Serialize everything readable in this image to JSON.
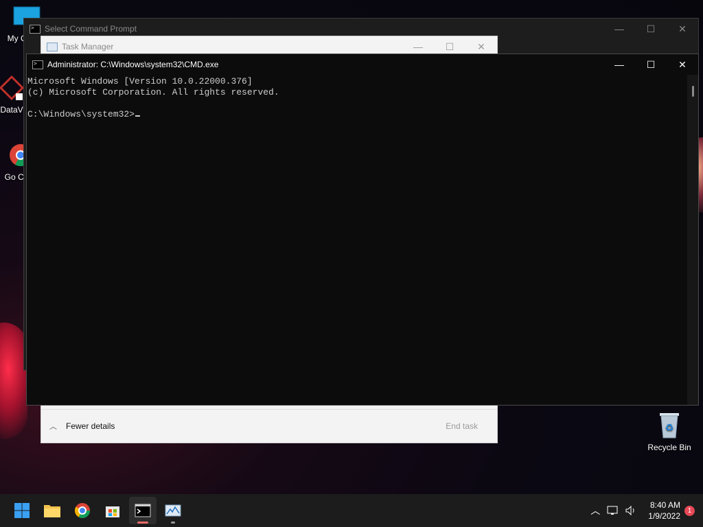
{
  "desktop": {
    "icons": [
      {
        "label": "My Co Mic",
        "icon": "computer-icon"
      },
      {
        "label": "DataV",
        "icon": "datav-icon"
      },
      {
        "label": "Go Chr",
        "icon": "chrome-icon"
      },
      {
        "label": "Recycle Bin",
        "icon": "recycle-bin-icon"
      }
    ]
  },
  "select_window": {
    "title": "Select Command Prompt"
  },
  "task_manager": {
    "title": "Task Manager",
    "fewer_details": "Fewer details",
    "end_task": "End task"
  },
  "cmd_window": {
    "title": "Administrator: C:\\Windows\\system32\\CMD.exe",
    "lines": [
      "Microsoft Windows [Version 10.0.22000.376]",
      "(c) Microsoft Corporation. All rights reserved.",
      "",
      "C:\\Windows\\system32>"
    ]
  },
  "taskbar": {
    "apps": [
      {
        "name": "Start",
        "icon": "windows-start-icon"
      },
      {
        "name": "File Explorer",
        "icon": "folder-icon"
      },
      {
        "name": "Google Chrome",
        "icon": "chrome-icon"
      },
      {
        "name": "Microsoft Store",
        "icon": "store-icon"
      },
      {
        "name": "Command Prompt",
        "icon": "cmd-icon"
      },
      {
        "name": "Task Manager",
        "icon": "task-manager-icon"
      }
    ],
    "time": "8:40 AM",
    "date": "1/9/2022",
    "notification_count": "1"
  },
  "colors": {
    "accent": "#0078d4",
    "notification": "#e74856",
    "cmd_active_indicator": "#f06a6a"
  }
}
